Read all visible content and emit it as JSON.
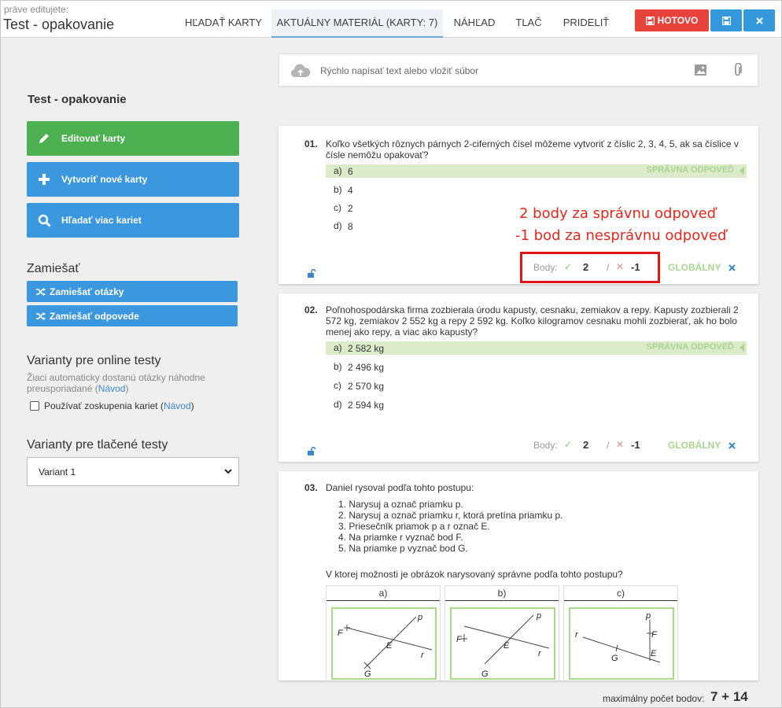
{
  "header": {
    "editing_hint": "práve editujete:",
    "doc_title": "Test - opakovanie",
    "tabs": [
      "HĽADAŤ KARTY",
      "AKTUÁLNY MATERIÁL (KARTY: 7)",
      "NÁHĽAD",
      "TLAČ",
      "PRIDELIŤ"
    ],
    "done_label": "HOTOVO"
  },
  "sidebar": {
    "title": "Test - opakovanie",
    "edit_cards": "Editovať karty",
    "create_cards": "Vytvoriť nové karty",
    "search_cards": "Hľadať viac kariet",
    "shuffle_heading": "Zamiešať",
    "shuffle_questions": "Zamiešať otázky",
    "shuffle_answers": "Zamiešať odpovede",
    "online_heading": "Varianty pre online testy",
    "online_desc": "Žiaci automaticky dostanú otázky náhodne preusporiadané",
    "guide_link": "Návod",
    "groups_label": "Používať zoskupenia kariet",
    "print_heading": "Varianty pre tlačené testy",
    "variant_selected": "Variant 1"
  },
  "quick": {
    "placeholder": "Rýchlo napísať text alebo vložiť súbor"
  },
  "q1": {
    "num": "01.",
    "text": "Koľko všetkých rôznych párnych 2-ciferných čísel môžeme vytvoriť z číslic 2, 3, 4, 5, ak sa číslice v čísle nemôžu opakovať?",
    "answers": [
      {
        "letter": "a)",
        "value": "6"
      },
      {
        "letter": "b)",
        "value": "4"
      },
      {
        "letter": "c)",
        "value": "2"
      },
      {
        "letter": "d)",
        "value": "8"
      }
    ],
    "correct_tag": "SPRÁVNA ODPOVEĎ",
    "points_label": "Body:",
    "plus": "2",
    "slash": "/",
    "minus": "-1",
    "global": "GLOBÁLNY"
  },
  "annotation": {
    "line1": "2 body za správnu odpoveď",
    "line2": "-1 bod za nesprávnu odpoveď",
    "color": "#e8271c"
  },
  "q2": {
    "num": "02.",
    "text": "Poľnohospodárska firma zozbierala úrodu kapusty, cesnaku, zemiakov a repy. Kapusty zozbierali 2 572 kg, zemiakov 2 552 kg a repy 2 592 kg. Koľko kilogramov cesnaku mohli zozbierať, ak ho bolo menej ako repy, a viac ako kapusty?",
    "answers": [
      {
        "letter": "a)",
        "value": "2 582 kg"
      },
      {
        "letter": "b)",
        "value": "2 496 kg"
      },
      {
        "letter": "c)",
        "value": "2 570 kg"
      },
      {
        "letter": "d)",
        "value": "2 594 kg"
      }
    ],
    "correct_tag": "SPRÁVNA ODPOVEĎ",
    "points_label": "Body:",
    "plus": "2",
    "slash": "/",
    "minus": "-1",
    "global": "GLOBÁLNY"
  },
  "q3": {
    "num": "03.",
    "text": "Daniel rysoval podľa tohto postupu:",
    "steps": [
      "1. Narysuj a označ priamku p.",
      "2. Narysuj a označ priamku r, ktorá pretína priamku p.",
      "3. Priesečník priamok p a r označ E.",
      "4. Na priamke r vyznač bod F.",
      "5. Na priamke p vyznač bod G."
    ],
    "question": "V ktorej možnosti je obrázok narysovaný správne podľa tohto postupu?",
    "options": [
      "a)",
      "b)",
      "c)"
    ],
    "figure_labels": {
      "p": "p",
      "r": "r",
      "E": "E",
      "F": "F",
      "G": "G"
    }
  },
  "footer": {
    "max_label": "maximálny počet bodov:",
    "max_value": "7 + 14"
  }
}
